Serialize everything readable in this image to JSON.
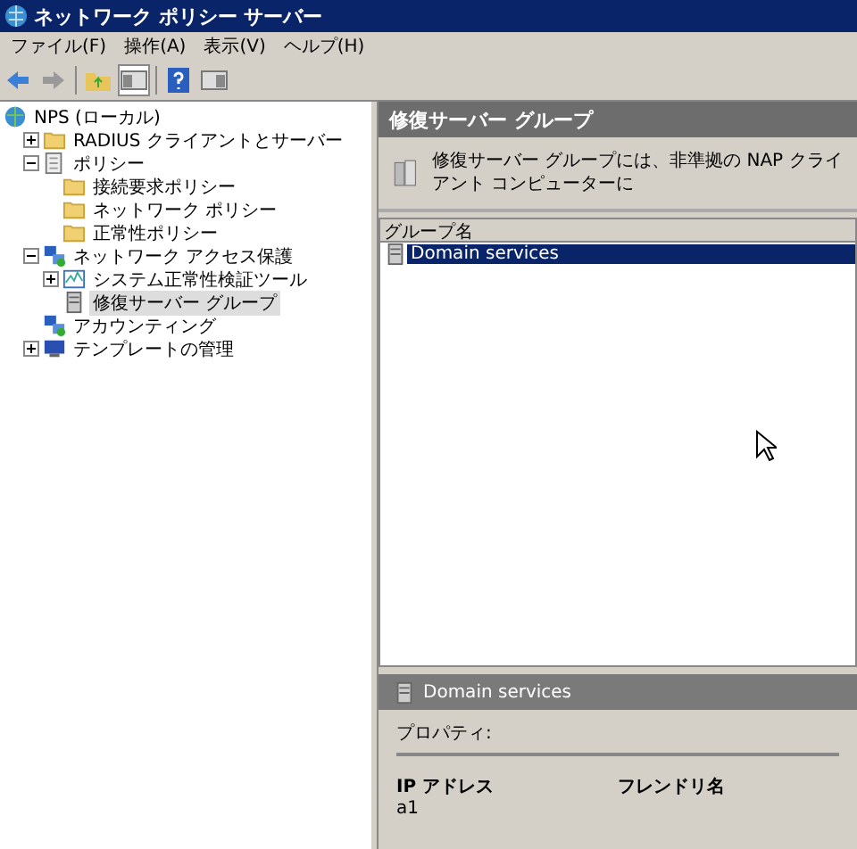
{
  "window": {
    "title": "ネットワーク ポリシー サーバー"
  },
  "menu": [
    "ファイル(F)",
    "操作(A)",
    "表示(V)",
    "ヘルプ(H)"
  ],
  "tree": [
    {
      "label": "NPS (ローカル)",
      "kind": "globe",
      "selected": false,
      "children": [
        {
          "label": "RADIUS クライアントとサーバー",
          "kind": "folder",
          "expanded": false,
          "selected": false
        },
        {
          "label": "ポリシー",
          "kind": "doc",
          "expanded": true,
          "selected": false,
          "children": [
            {
              "label": "接続要求ポリシー",
              "kind": "folder",
              "selected": false
            },
            {
              "label": "ネットワーク ポリシー",
              "kind": "folder",
              "selected": false
            },
            {
              "label": "正常性ポリシー",
              "kind": "folder",
              "selected": false
            }
          ]
        },
        {
          "label": "ネットワーク アクセス保護",
          "kind": "network",
          "expanded": true,
          "selected": false,
          "children": [
            {
              "label": "システム正常性検証ツール",
              "kind": "chart",
              "expanded": false,
              "selected": false
            },
            {
              "label": "修復サーバー グループ",
              "kind": "server",
              "selected": true
            }
          ]
        },
        {
          "label": "アカウンティング",
          "kind": "network",
          "selected": false
        },
        {
          "label": "テンプレートの管理",
          "kind": "monitor",
          "expanded": false,
          "selected": false
        }
      ]
    }
  ],
  "pane": {
    "title": "修復サーバー グループ",
    "description": "修復サーバー グループには、非準拠の NAP クライアント コンピューターに",
    "list": {
      "column": "グループ名",
      "rows": [
        {
          "name": "Domain services",
          "selected": true
        }
      ]
    }
  },
  "details": {
    "title": "Domain services",
    "section": "プロパティ:",
    "columns": [
      {
        "heading": "IP アドレス",
        "value": "a1"
      },
      {
        "heading": "フレンドリ名"
      }
    ]
  }
}
